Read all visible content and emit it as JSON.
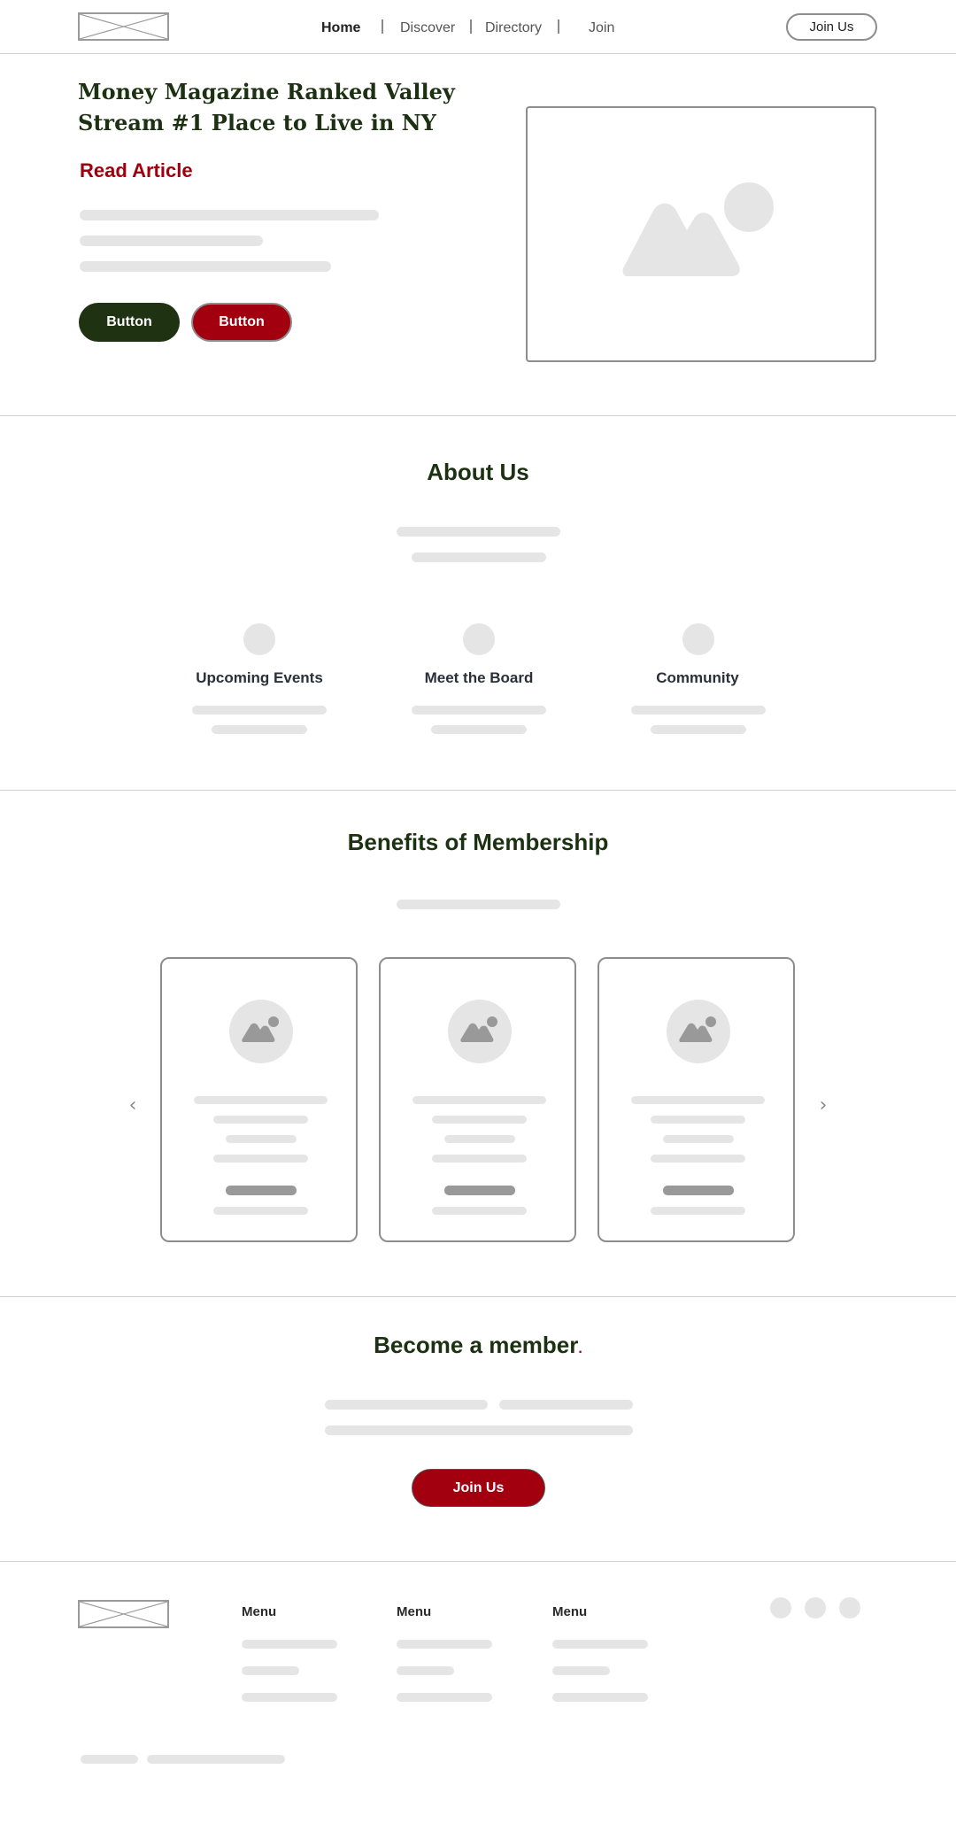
{
  "header": {
    "logo": "logo-placeholder",
    "nav": [
      {
        "label": "Home",
        "active": true
      },
      {
        "label": "Discover",
        "active": false
      },
      {
        "label": "Directory",
        "active": false
      },
      {
        "label": "Join",
        "active": false
      }
    ],
    "cta_label": "Join Us"
  },
  "hero": {
    "title": "Money Magazine Ranked Valley Stream #1 Place to Live in NY",
    "link_label": "Read Article",
    "primary_button": "Button",
    "secondary_button": "Button",
    "image_icon": "image-placeholder-icon"
  },
  "about": {
    "title": "About Us",
    "features": [
      {
        "label": "Upcoming Events"
      },
      {
        "label": "Meet the Board"
      },
      {
        "label": "Community"
      }
    ]
  },
  "benefits": {
    "title": "Benefits of Membership",
    "prev_icon": "chevron-left-icon",
    "next_icon": "chevron-right-icon"
  },
  "become_member": {
    "title": "Become a member",
    "title_suffix": ".",
    "button_label": "Join Us"
  },
  "footer": {
    "menus": [
      {
        "heading": "Menu"
      },
      {
        "heading": "Menu"
      },
      {
        "heading": "Menu"
      }
    ],
    "social_icons": [
      "social-icon",
      "social-icon",
      "social-icon"
    ]
  },
  "colors": {
    "brand_green": "#1c3111",
    "brand_red": "#a2000f",
    "placeholder": "#e5e5e5",
    "border": "#8d8d8d"
  }
}
